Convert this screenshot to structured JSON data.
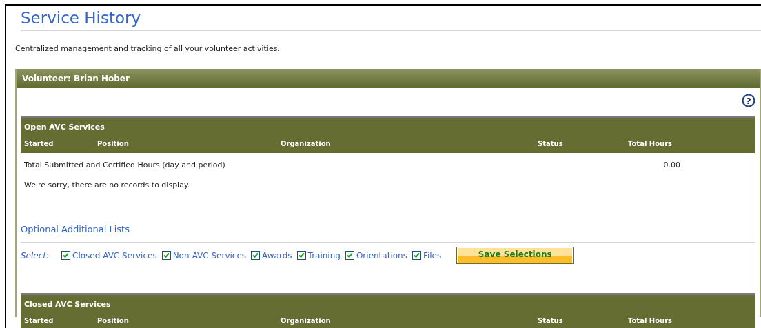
{
  "page": {
    "title": "Service History",
    "description": "Centralized management and tracking of all your volunteer activities."
  },
  "panel": {
    "title": "Volunteer: Brian Hober",
    "help_button": "?"
  },
  "open_table": {
    "title": "Open AVC Services",
    "columns": [
      "Started",
      "Position",
      "Organization",
      "Status",
      "Total Hours"
    ],
    "total_label": "Total Submitted and Certified Hours (day and period)",
    "total_value": "0.00",
    "empty_message": "We're sorry, there are no records to display."
  },
  "optional_lists": {
    "title": "Optional Additional Lists",
    "select_label": "Select:",
    "options": [
      {
        "label": "Closed AVC Services",
        "checked": true
      },
      {
        "label": "Non-AVC Services",
        "checked": true
      },
      {
        "label": "Awards",
        "checked": true
      },
      {
        "label": "Training",
        "checked": true
      },
      {
        "label": "Orientations",
        "checked": true
      },
      {
        "label": "Files",
        "checked": true
      }
    ],
    "save_button": "Save Selections"
  },
  "closed_table": {
    "title": "Closed AVC Services",
    "columns": [
      "Started",
      "Position",
      "Organization",
      "Status",
      "Total Hours"
    ]
  }
}
